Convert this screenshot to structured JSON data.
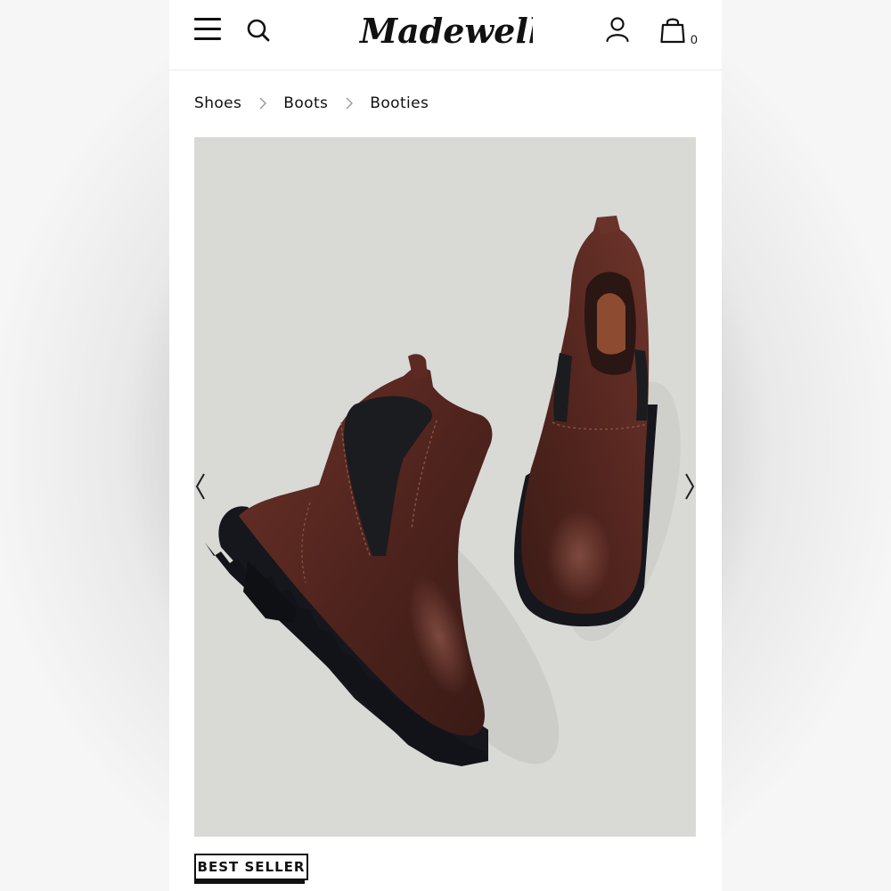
{
  "header": {
    "brand": "Madewell",
    "bag_count": "0",
    "icons": [
      "hamburger-menu-icon",
      "search-icon",
      "account-icon",
      "shopping-bag-icon"
    ]
  },
  "breadcrumb": {
    "items": [
      "Shoes",
      "Boots",
      "Booties"
    ]
  },
  "product": {
    "badge": "BEST SELLER",
    "image_background": "#d9d9d6",
    "leather_color": "#5a2a22",
    "sole_color": "#15171c",
    "gallery_icons": [
      "chevron-left-icon",
      "chevron-right-icon"
    ]
  },
  "colors": {
    "text": "#111111",
    "background": "#ffffff"
  }
}
